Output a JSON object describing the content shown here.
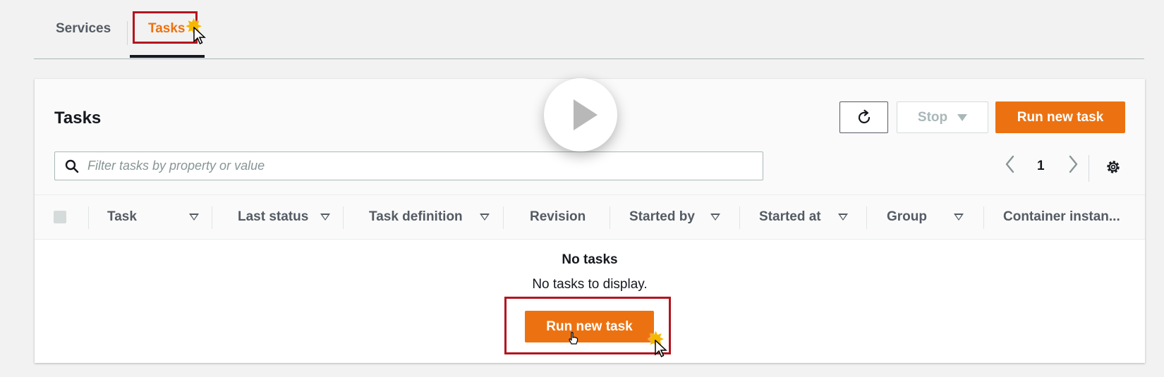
{
  "tabs": {
    "services_label": "Services",
    "tasks_label": "Tasks",
    "active": "Tasks"
  },
  "panel": {
    "title": "Tasks",
    "stop_label": "Stop",
    "run_new_task_label": "Run new task",
    "search_placeholder": "Filter tasks by property or value",
    "page_number": "1"
  },
  "table": {
    "columns": [
      "Task",
      "Last status",
      "Task definition",
      "Revision",
      "Started by",
      "Started at",
      "Group",
      "Container instan..."
    ],
    "empty_title": "No tasks",
    "empty_description": "No tasks to display.",
    "empty_button_label": "Run new task"
  },
  "colors": {
    "accent": "#ec7211",
    "highlight": "#b3151e",
    "text": "#16191f",
    "muted": "#545b64"
  },
  "icons": [
    "refresh-icon",
    "caret-down-icon",
    "search-icon",
    "chevron-left-icon",
    "chevron-right-icon",
    "gear-icon",
    "play-icon",
    "cursor-icon",
    "click-star-icon"
  ]
}
